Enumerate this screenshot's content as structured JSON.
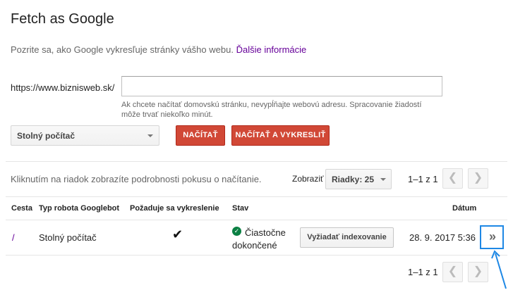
{
  "page": {
    "title": "Fetch as Google",
    "intro_text": "Pozrite sa, ako Google vykresľuje stránky vášho webu.",
    "intro_link": "Ďalšie informácie"
  },
  "form": {
    "url_prefix": "https://www.biznisweb.sk/",
    "url_value": "",
    "hint": "Ak chcete načítať domovskú stránku, nevypĺňajte webovú adresu. Spracovanie žiadostí môže trvať niekoľko minút.",
    "device_selected": "Stolný počítač",
    "fetch_label": "NAČÍTAŤ",
    "fetch_render_label": "NAČÍTAŤ A VYKRESLIŤ"
  },
  "results": {
    "hint": "Kliknutím na riadok zobrazíte podrobnosti pokusu o načítanie.",
    "show_label": "Zobraziť",
    "rows_selected": "Riadky: 25",
    "pager_text": "1–1 z 1",
    "prev_icon": "chevron-left",
    "next_icon": "chevron-right",
    "columns": {
      "path": "Cesta",
      "bot": "Typ robota Googlebot",
      "render": "Požaduje sa vykreslenie",
      "status": "Stav",
      "date": "Dátum"
    },
    "rows": [
      {
        "path": "/",
        "bot": "Stolný počítač",
        "render_check": "✔",
        "status_line1": "Čiastočne",
        "status_line2": "dokončené",
        "request_index_label": "Vyžiadať indexovanie",
        "date": "28. 9. 2017 5:36",
        "detail_glyph": "»"
      }
    ]
  },
  "colors": {
    "accent_red": "#d14836",
    "link_purple": "#660099",
    "highlight_blue": "#1e88e5",
    "status_green": "#0b8043"
  }
}
